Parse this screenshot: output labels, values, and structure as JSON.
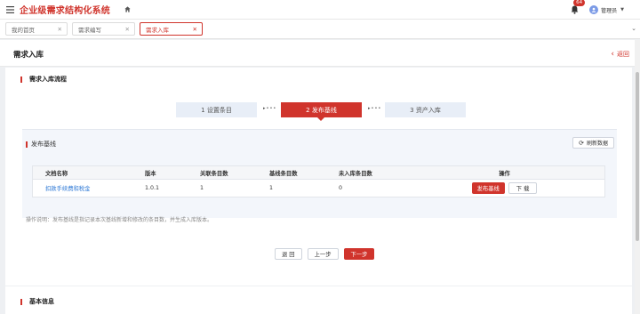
{
  "header": {
    "app_title": "企业级需求结构化系统",
    "notification_count": "64",
    "user_name": "管理员"
  },
  "tabs": [
    {
      "label": "我的首页",
      "active": false
    },
    {
      "label": "需求编写",
      "active": false
    },
    {
      "label": "需求入库",
      "active": true
    }
  ],
  "page": {
    "title": "需求入库",
    "back_label": "返回"
  },
  "flow_section": {
    "title": "需求入库流程",
    "steps": [
      {
        "label": "1 设置条目",
        "state": "done"
      },
      {
        "label": "2 发布基线",
        "state": "current"
      },
      {
        "label": "3 资产入库",
        "state": "todo"
      }
    ]
  },
  "publish_panel": {
    "title": "发布基线",
    "refresh_label": "刷新数据",
    "columns": [
      "文档名称",
      "版本",
      "关联条目数",
      "基线条目数",
      "未入库条目数",
      "操作"
    ],
    "rows": [
      {
        "name": "扣款手续费和税金",
        "version": "1.0.1",
        "linked": "1",
        "baseline": "1",
        "not_stored": "0",
        "publish_label": "发布基线",
        "download_label": "下 载"
      }
    ],
    "note": "操作说明：发布基线是指记录本次基线新增和修改的条目数，并生成入库版本。"
  },
  "footer_buttons": {
    "back": "退 回",
    "prev": "上一步",
    "next": "下一步"
  },
  "basic_section": {
    "title": "基本信息"
  },
  "colors": {
    "accent": "#d0342c",
    "link": "#2f7ad6",
    "step_inactive": "#e8eef7",
    "panel_bg": "#f3f6fb"
  }
}
